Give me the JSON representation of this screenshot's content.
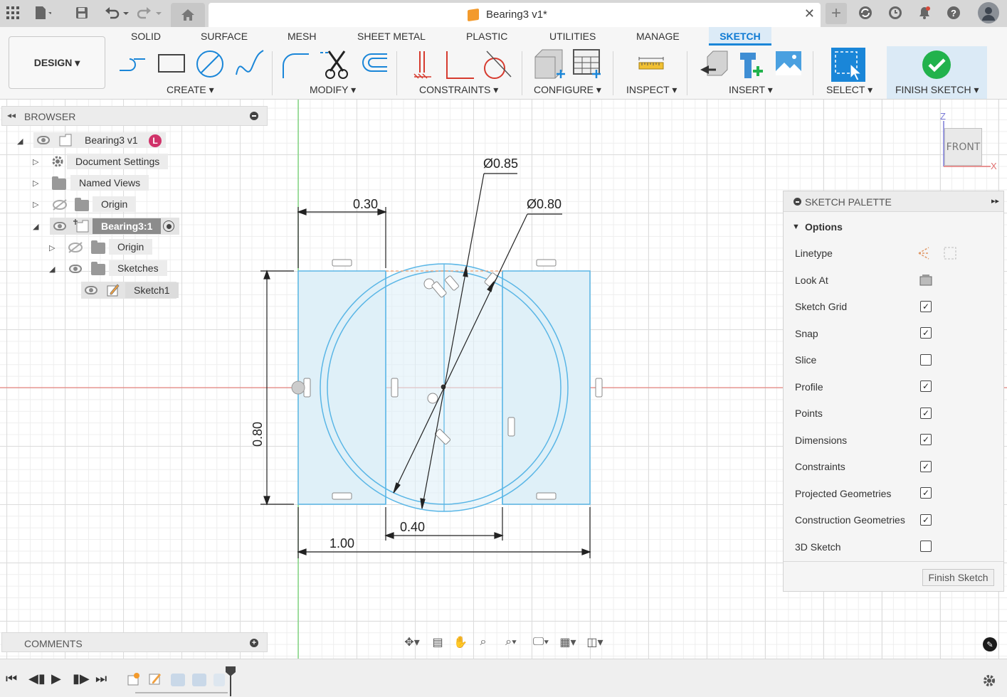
{
  "window": {
    "doc_title": "Bearing3 v1*",
    "user_initial": "L"
  },
  "ribbon": {
    "workspace": "DESIGN ▾",
    "tabs": [
      "SOLID",
      "SURFACE",
      "MESH",
      "SHEET METAL",
      "PLASTIC",
      "UTILITIES",
      "MANAGE",
      "SKETCH"
    ],
    "active_tab": "SKETCH",
    "groups": {
      "create": "CREATE ▾",
      "modify": "MODIFY ▾",
      "constraints": "CONSTRAINTS ▾",
      "configure": "CONFIGURE ▾",
      "inspect": "INSPECT ▾",
      "insert": "INSERT ▾",
      "select": "SELECT ▾",
      "finish": "FINISH SKETCH ▾"
    }
  },
  "browser": {
    "title": "BROWSER",
    "items": [
      {
        "label": "Bearing3 v1"
      },
      {
        "label": "Document Settings"
      },
      {
        "label": "Named Views"
      },
      {
        "label": "Origin"
      },
      {
        "label": "Bearing3:1"
      },
      {
        "label": "Origin"
      },
      {
        "label": "Sketches"
      },
      {
        "label": "Sketch1"
      }
    ]
  },
  "comments": {
    "title": "COMMENTS"
  },
  "viewcube": {
    "face": "FRONT",
    "axis_z": "Z",
    "axis_x": "X"
  },
  "sketch": {
    "dim_top_left": "0.30",
    "dim_dia_outer": "Ø0.85",
    "dim_dia_inner": "Ø0.80",
    "dim_height": "0.80",
    "dim_inner_width": "0.40",
    "dim_total_width": "1.00"
  },
  "palette": {
    "title": "SKETCH PALETTE",
    "section": "Options",
    "rows": [
      {
        "label": "Linetype",
        "type": "icons"
      },
      {
        "label": "Look At",
        "type": "icon"
      },
      {
        "label": "Sketch Grid",
        "checked": true
      },
      {
        "label": "Snap",
        "checked": true
      },
      {
        "label": "Slice",
        "checked": false
      },
      {
        "label": "Profile",
        "checked": true
      },
      {
        "label": "Points",
        "checked": true
      },
      {
        "label": "Dimensions",
        "checked": true
      },
      {
        "label": "Constraints",
        "checked": true
      },
      {
        "label": "Projected Geometries",
        "checked": true
      },
      {
        "label": "Construction Geometries",
        "checked": true
      },
      {
        "label": "3D Sketch",
        "checked": false
      }
    ],
    "finish_button": "Finish Sketch"
  },
  "colors": {
    "sketch_line": "#5ab6e6",
    "profile_fill": "#dff0f8",
    "accent": "#1a86d8",
    "finish_green": "#22b24c"
  }
}
